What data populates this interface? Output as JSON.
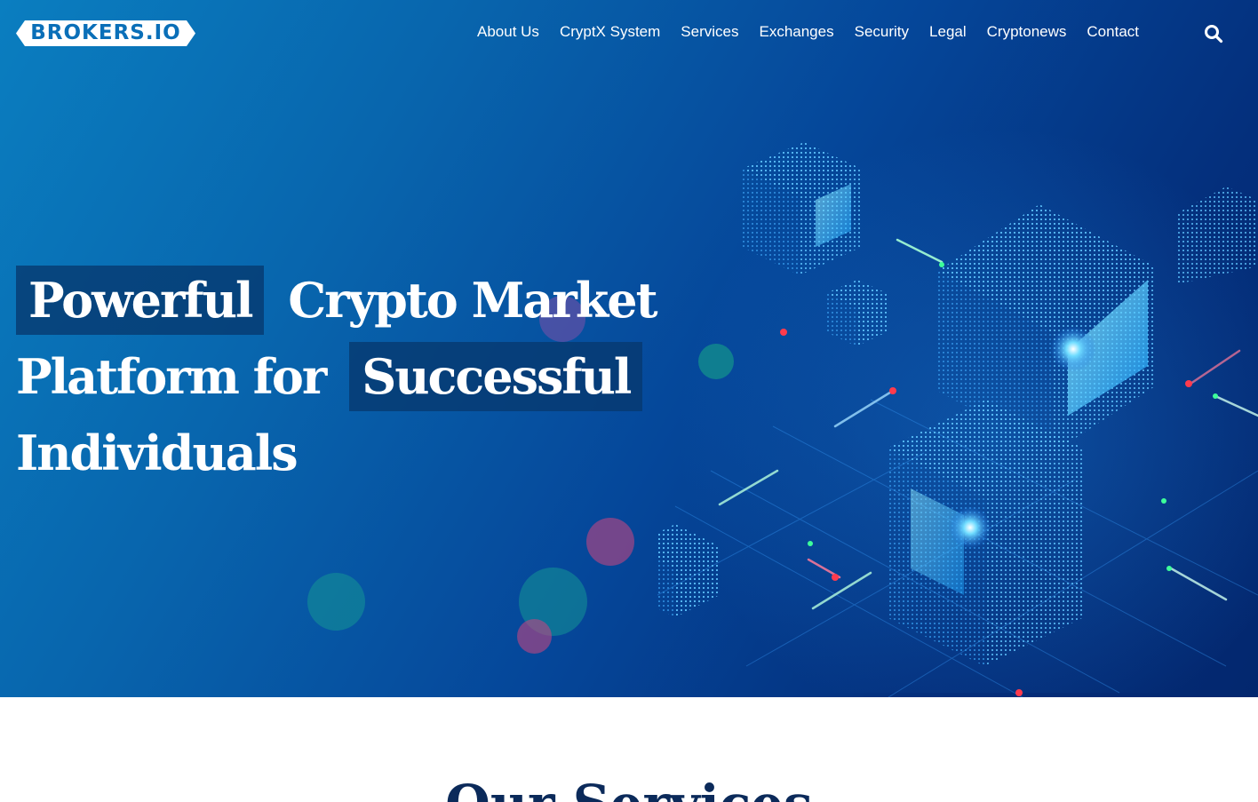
{
  "logo": {
    "text": "BROKERS.IO"
  },
  "nav": {
    "items": [
      {
        "label": "About Us"
      },
      {
        "label": "CryptX System"
      },
      {
        "label": "Services"
      },
      {
        "label": "Exchanges"
      },
      {
        "label": "Security"
      },
      {
        "label": "Legal"
      },
      {
        "label": "Cryptonews"
      },
      {
        "label": "Contact"
      }
    ],
    "search_icon": "search-icon"
  },
  "hero": {
    "line1_highlight": "Powerful",
    "line1_rest": "Crypto Market",
    "line2_plain": "Platform for",
    "line2_highlight": "Successful",
    "line3": "Individuals",
    "artwork": "isometric-blockchain-cubes-illustration"
  },
  "services": {
    "title": "Our Services"
  },
  "colors": {
    "hero_start": "#0a7ec0",
    "hero_end": "#03276e",
    "highlight_bg": "#06386e",
    "logo_blue": "#0a6fb8",
    "title_navy": "#0b2a5a"
  }
}
